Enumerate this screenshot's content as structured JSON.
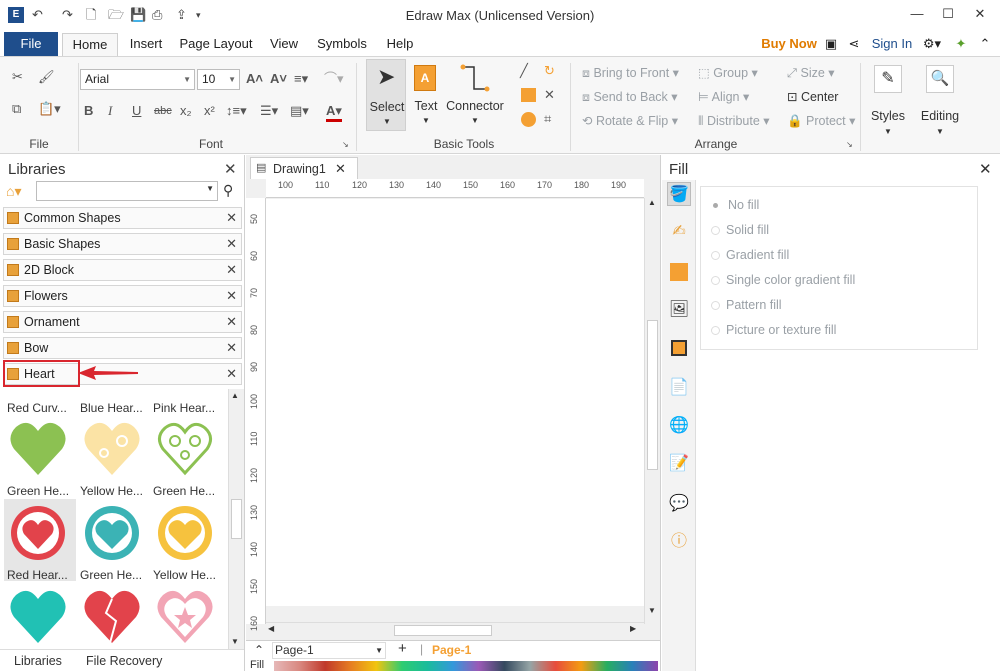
{
  "window": {
    "title": "Edraw Max (Unlicensed Version)",
    "controls": [
      "—",
      "☐",
      "✕"
    ]
  },
  "tabs": [
    "File",
    "Home",
    "Insert",
    "Page Layout",
    "View",
    "Symbols",
    "Help"
  ],
  "header_right": {
    "buy_now": "Buy Now",
    "sign_in": "Sign In"
  },
  "ribbon": {
    "font": {
      "family": "Arial",
      "size": "10",
      "group_label": "Font"
    },
    "file_group_label": "File",
    "basic_tools": {
      "select": "Select",
      "text": "Text",
      "connector": "Connector",
      "group_label": "Basic Tools"
    },
    "arrange": {
      "bring_to_front": "Bring to Front",
      "send_to_back": "Send to Back",
      "rotate_flip": "Rotate & Flip",
      "group": "Group",
      "align": "Align",
      "distribute": "Distribute",
      "size": "Size",
      "center": "Center",
      "protect": "Protect",
      "group_label": "Arrange"
    },
    "styles": "Styles",
    "editing": "Editing"
  },
  "libraries": {
    "title": "Libraries",
    "items": [
      "Common Shapes",
      "Basic Shapes",
      "2D Block",
      "Flowers",
      "Ornament",
      "Bow",
      "Heart"
    ],
    "shapes_row0": [
      "Red Curv...",
      "Blue Hear...",
      "Pink Hear..."
    ],
    "shapes_row1": [
      "Green He...",
      "Yellow He...",
      "Green He..."
    ],
    "shapes_row2": [
      "Red Hear...",
      "Green He...",
      "Yellow He..."
    ],
    "bottom_tabs": [
      "Libraries",
      "File Recovery"
    ]
  },
  "document": {
    "tab": "Drawing1",
    "page_select": "Page-1",
    "page_tab": "Page-1",
    "fill_label": "Fill"
  },
  "ruler": {
    "h": [
      "100",
      "110",
      "120",
      "130",
      "140",
      "150",
      "160",
      "170",
      "180",
      "190"
    ],
    "v": [
      "50",
      "60",
      "70",
      "80",
      "90",
      "100",
      "110",
      "120",
      "130",
      "140",
      "150",
      "160"
    ]
  },
  "fill_panel": {
    "title": "Fill",
    "options": [
      "No fill",
      "Solid fill",
      "Gradient fill",
      "Single color gradient fill",
      "Pattern fill",
      "Picture or texture fill"
    ]
  },
  "colors": {
    "accent": "#1f4e8c",
    "highlight_red": "#d9262e",
    "buy_now": "#e07b00"
  }
}
